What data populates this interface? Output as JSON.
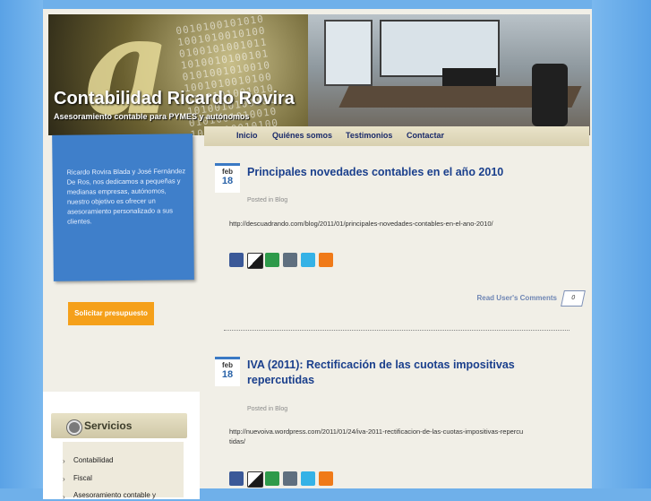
{
  "header": {
    "site_title": "Contabilidad Ricardo Rovira",
    "tagline": "Asesoramiento contable para PYMES y autónomos"
  },
  "nav": {
    "items": [
      {
        "label": "Inicio"
      },
      {
        "label": "Quiénes somos"
      },
      {
        "label": "Testimonios"
      },
      {
        "label": "Contactar"
      }
    ]
  },
  "sidebar": {
    "intro_text": "Ricardo Rovira Blada y José Fernández De Ros, nos dedicamos a pequeñas y medianas empresas, autónomos, nuestro objetivo es ofrecer un asesoramiento personalizado a sus clientes.",
    "cta_label": "Solicitar presupuesto",
    "servicios": {
      "title": "Servicios",
      "items": [
        {
          "label": "Contabilidad"
        },
        {
          "label": "Fiscal"
        },
        {
          "label": "Asesoramiento contable y"
        }
      ]
    }
  },
  "posts": [
    {
      "month": "feb",
      "day": "18",
      "title": "Principales novedades contables en el año 2010",
      "posted": "Posted in Blog",
      "url": "http://descuadrando.com/blog/2011/01/principales-novedades-contables-en-el-ano-2010/",
      "read_more": "Read User's Comments",
      "comment_count": "0"
    },
    {
      "month": "feb",
      "day": "18",
      "title": "IVA (2011): Rectificación de las cuotas impositivas repercutidas",
      "posted": "Posted in Blog",
      "url": "http://nuevoiva.wordpress.com/2011/01/24/iva-2011-rectificacion-de-las-cuotas-impositivas-repercutidas/"
    }
  ],
  "share_icons": [
    {
      "name": "facebook-share-icon",
      "color": "#3b5998"
    },
    {
      "name": "delicious-share-icon",
      "color": "#1a1a1a"
    },
    {
      "name": "stumbleupon-share-icon",
      "color": "#2e9a4a"
    },
    {
      "name": "digg-share-icon",
      "color": "#5f6f7f"
    },
    {
      "name": "twitter-share-icon",
      "color": "#35b2e6"
    },
    {
      "name": "rss-share-icon",
      "color": "#f07a18"
    }
  ]
}
